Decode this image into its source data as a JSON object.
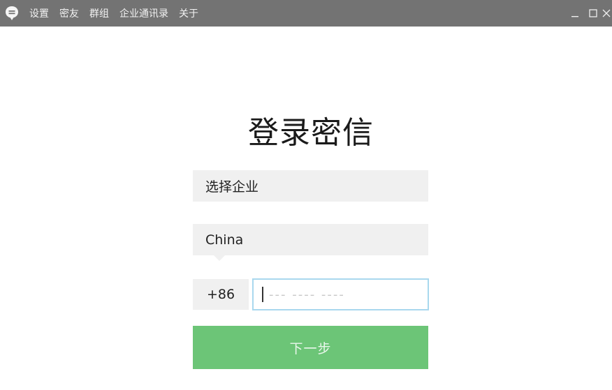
{
  "app": {
    "logo_icon": "chat-bubble-icon"
  },
  "menu": {
    "items": [
      "设置",
      "密友",
      "群组",
      "企业通讯录",
      "关于"
    ]
  },
  "window_controls": {
    "minimize": "_",
    "maximize": "☐",
    "close": "✕"
  },
  "login": {
    "title": "登录密信",
    "enterprise_select": "选择企业",
    "country_select": "China",
    "country_code": "+86",
    "phone_placeholder": "--- ---- ----",
    "phone_value": "",
    "next_button": "下一步"
  },
  "colors": {
    "titlebar": "#737373",
    "field_bg": "#f0f0f0",
    "input_focus_border": "#a9d8ee",
    "primary_button": "#6cc577"
  }
}
